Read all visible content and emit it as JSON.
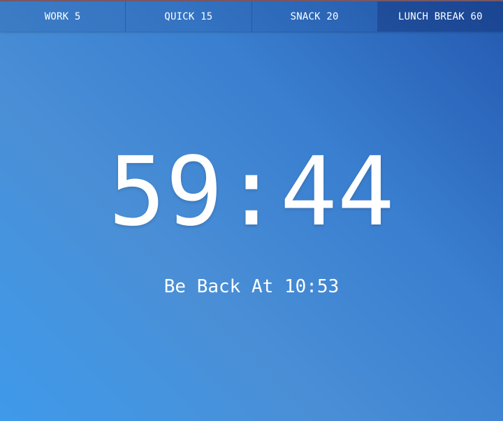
{
  "tabs": [
    {
      "label": "WORK 5"
    },
    {
      "label": "QUICK 15"
    },
    {
      "label": "SNACK 20"
    },
    {
      "label": "LUNCH BREAK 60"
    }
  ],
  "active_tab": "LUNCH BREAK 60",
  "timer": {
    "display": "59:44"
  },
  "return_message": "Be Back At 10:53",
  "colors": {
    "background_top_right": "#2459b0",
    "background_bottom_left": "#3f9aea",
    "text": "#ffffff"
  }
}
